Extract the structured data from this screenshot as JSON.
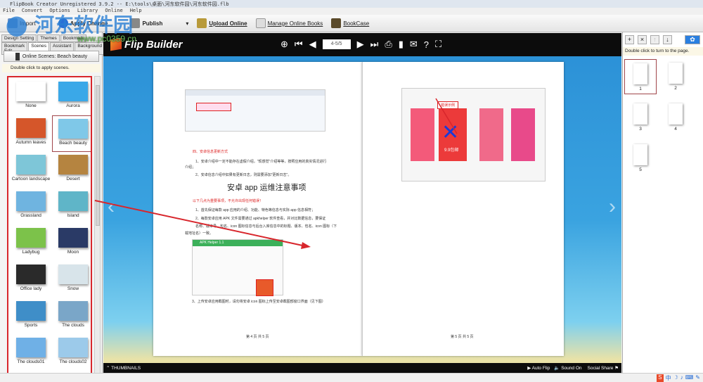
{
  "window": {
    "title": "FlipBook Creator Unregistered 3.9.2  -- E:\\tools\\桌面\\河东软件园\\河东软件园.flb"
  },
  "menu": [
    "File",
    "Convert",
    "Options",
    "Library",
    "Online",
    "Help"
  ],
  "toolbar": {
    "import": "Import",
    "apply": "Apply Change",
    "publish": "Publish",
    "upload": "Upload Online",
    "manage": "Manage Online Books",
    "bookcase": "BookCase"
  },
  "watermark": {
    "logo": "河东软件园",
    "url": "www.pc0359.cn"
  },
  "left": {
    "tabs_row1": [
      "Design Setting",
      "Themes",
      "Bookmark"
    ],
    "tabs_row2": [
      "Bookmark Edit",
      "Scenes",
      "Assistant",
      "Background"
    ],
    "online_button": "Online Scenes: Beach beauty",
    "hint": "Double click to apply scenes.",
    "scenes": [
      {
        "name": "None",
        "color": "#ffffff"
      },
      {
        "name": "Aurora",
        "color": "#3aa8e8"
      },
      {
        "name": "Autumn leaves",
        "color": "#d5562a"
      },
      {
        "name": "Beach beauty",
        "color": "#7fc8e8"
      },
      {
        "name": "Cartoon landscape",
        "color": "#7ec6d8"
      },
      {
        "name": "Desert",
        "color": "#b58440"
      },
      {
        "name": "Grassland",
        "color": "#6fb4e0"
      },
      {
        "name": "Island",
        "color": "#5fb5c8"
      },
      {
        "name": "Ladybug",
        "color": "#7cc24a"
      },
      {
        "name": "Moon",
        "color": "#2a3a66"
      },
      {
        "name": "Office lady",
        "color": "#2a2a2a"
      },
      {
        "name": "Snow",
        "color": "#d8e4ea"
      },
      {
        "name": "Sports",
        "color": "#3f8ec8"
      },
      {
        "name": "The clouds",
        "color": "#7aa6c8"
      },
      {
        "name": "The clouds01",
        "color": "#6fb0e6"
      },
      {
        "name": "The clouds02",
        "color": "#9ccaea"
      }
    ],
    "selected": "Beach beauty"
  },
  "viewer": {
    "brand": "Flip Builder",
    "page_indicator": "4-5/5",
    "thumbnails": "THUMBNAILS",
    "autoflip": "Auto Flip",
    "sound": "Sound On",
    "share": "Social Share",
    "left_page": {
      "h1": "四、安卓信息更新方式",
      "p1": "1、安卓介绍中一定不能存在虚假介绍，\"现感觉\"介绍等等，按照应用的真实情况进行",
      "p1b": "介绍；",
      "p2": "2、安卓信息介绍中如果有更新日志，则需要添加\"更新日志\"。",
      "title": "安卓 app 运维注意事项",
      "red": "以下几点为重要事项，不允许出现任何错误！",
      "l1": "1、首先保证每款 app 应用的介绍、功能、特色等信息与实际 app 信息相符；",
      "l2": "2、每款安卓应用 APK 文件需要通过 apkhelper 软件查看，并对比数据信息，要保证",
      "l2b": "名称、版本号、包名、icon 图标信息与后台入库信息中的标题、版本、包名、icon 图标（下",
      "l2c": "载地址名）一致。",
      "dialog": "APK Helper 1.1",
      "l3": "3、上传安卓应用截图时，请勿将安卓 icon 图标上传至安卓截图部窗口界面（见下图）",
      "footer": "第 4 页 共 5 页"
    },
    "right_page": {
      "label": "错误示例",
      "price": "9.9包邮",
      "footer": "第 5 页 共 5 页"
    }
  },
  "right": {
    "hint": "Double click to turn to the page.",
    "pages": [
      "1",
      "2",
      "3",
      "4",
      "5"
    ],
    "selected": "1"
  },
  "colors": {
    "accent_red": "#d8262c",
    "viewer_bg": "#2a8fd6"
  }
}
